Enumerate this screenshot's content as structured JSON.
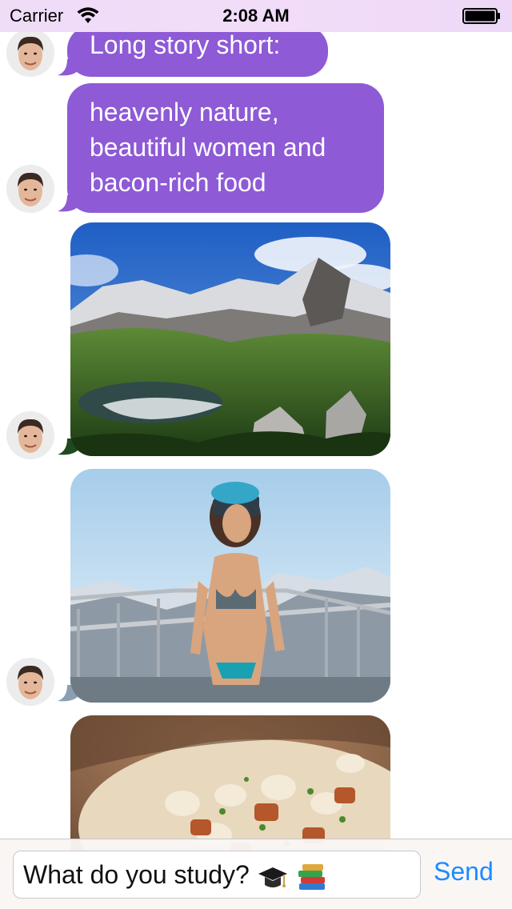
{
  "status_bar": {
    "carrier": "Carrier",
    "time": "2:08 AM",
    "wifi_icon": "wifi-icon",
    "battery_icon": "battery-full-icon"
  },
  "colors": {
    "bubble": "#8e5ad6",
    "bubble_text": "#ffffff",
    "send": "#1a8cff",
    "status_bar_tint": "#efdcf7"
  },
  "messages": [
    {
      "type": "text",
      "lines": [
        "Long story short:"
      ]
    },
    {
      "type": "text",
      "lines": [
        "heavenly nature,",
        "beautiful women and",
        "bacon-rich food"
      ]
    },
    {
      "type": "image",
      "content": "mountain-lake-landscape"
    },
    {
      "type": "image",
      "content": "skier-woman-photo"
    },
    {
      "type": "image",
      "content": "bacon-dumplings-food"
    }
  ],
  "composer": {
    "text": "What do you study?",
    "emoji": [
      "graduation-cap-emoji",
      "books-emoji"
    ],
    "send_label": "Send"
  }
}
